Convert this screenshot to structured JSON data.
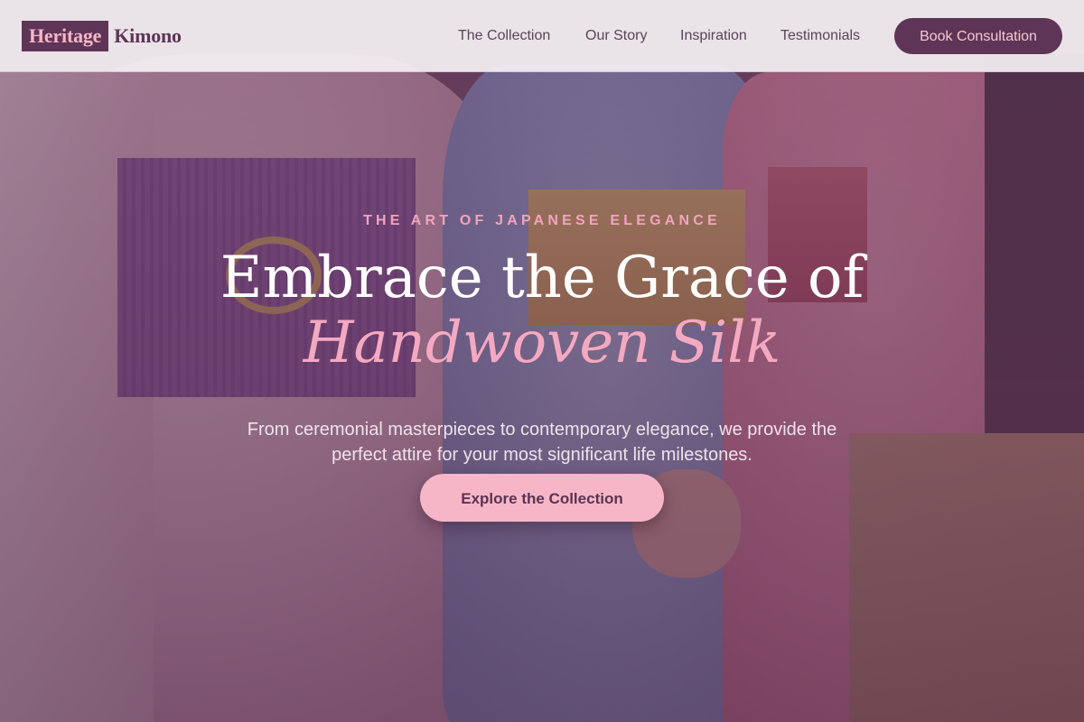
{
  "brand": {
    "name_primary": "Heritage",
    "name_secondary": "Kimono",
    "colors": {
      "plum": "#5e3556",
      "pink": "#f7b6c8",
      "header_bg": "#f4f0f3"
    }
  },
  "nav": {
    "items": [
      {
        "label": "The Collection"
      },
      {
        "label": "Our Story"
      },
      {
        "label": "Inspiration"
      },
      {
        "label": "Testimonials"
      }
    ],
    "cta_label": "Book Consultation"
  },
  "hero": {
    "eyebrow": "THE ART OF JAPANESE ELEGANCE",
    "headline_line1": "Embrace the Grace of",
    "headline_line2": "Handwoven Silk",
    "subtext": "From ceremonial masterpieces to contemporary elegance, we provide the perfect attire for your most significant life milestones.",
    "cta_label": "Explore the Collection",
    "background_image": "kimono-photo"
  }
}
